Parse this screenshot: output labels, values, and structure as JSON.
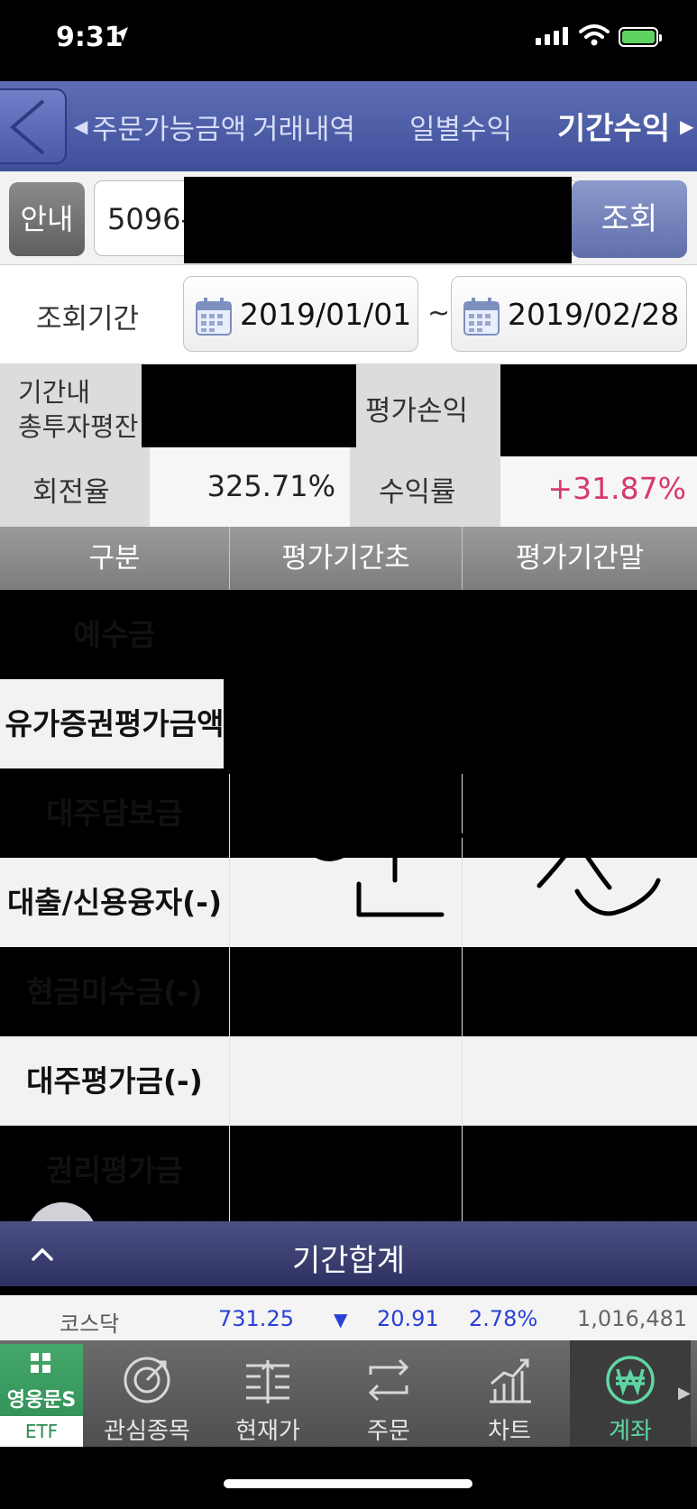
{
  "status": {
    "time": "9:31"
  },
  "tabs": {
    "items": [
      "주문가능금액",
      "거래내역",
      "일별수익",
      "기간수익"
    ],
    "active": "기간수익"
  },
  "account": {
    "info_label": "안내",
    "number_prefix": "5096-",
    "search_label": "조회"
  },
  "period": {
    "label": "조회기간",
    "start": "2019/01/01",
    "separator": "~",
    "end": "2019/02/28"
  },
  "summary": {
    "avg_label_line1": "기간내",
    "avg_label_line2": "총투자평잔",
    "pnl_label": "평가손익",
    "turnover_label": "회전율",
    "turnover_value": "325.71%",
    "return_label": "수익률",
    "return_value": "+31.87%"
  },
  "table": {
    "headers": [
      "구분",
      "평가기간초",
      "평가기간말"
    ],
    "rows": [
      "예수금",
      "유가증권평가금액",
      "대주담보금",
      "대출/신용융자(-)",
      "현금미수금(-)",
      "대주평가금(-)",
      "권리평가금"
    ]
  },
  "sum_bar": {
    "label": "기간합계"
  },
  "ticker": {
    "name": "코스닥",
    "index": "731.25",
    "change": "20.91",
    "rate": "2.78%",
    "volume": "1,016,481"
  },
  "nav": {
    "brand": "영웅문S",
    "etf": "ETF",
    "items": [
      "관심종목",
      "현재가",
      "주문",
      "차트",
      "계좌"
    ],
    "active": "계좌"
  },
  "colors": {
    "tab_bar": "#4a5aa7",
    "return_positive": "#d63a6a",
    "index_blue": "#2a3fd6",
    "nav_active": "#5fd6a3",
    "etf_green": "#2d8a52"
  }
}
